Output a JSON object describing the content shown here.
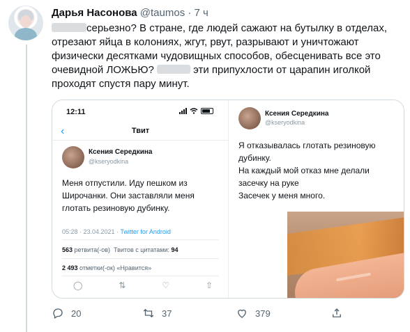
{
  "author": {
    "name": "Дарья Насонова",
    "handle": "@taumos",
    "time": "7 ч"
  },
  "tweet": {
    "line1": "серьезно? В стране, где людей сажают на бутылку в отделах,",
    "line2": "отрезают яйца в колониях, жгут, рвут, разрывают и уничтожают",
    "line3": "физически десятками чудовищных способов, обесценивать все это",
    "line4a": "очевидной ЛОЖЬЮ?",
    "line4b": "эти припухлости от царапин иголкой",
    "line5": "проходят спустя пару минут."
  },
  "screenshot_left": {
    "time": "12:11",
    "nav_back": "‹",
    "nav_title": "Твит",
    "name": "Ксения Середкина",
    "handle": "@kseryodkina",
    "text_l1": "Меня отпустили. Иду пешком из",
    "text_l2": "Широчанки. Они заставляли меня",
    "text_l3": "глотать резиновую дубинку.",
    "meta_time": "05:28 · 23.04.2021 · ",
    "meta_source": "Twitter for Android",
    "retweets_count": "563",
    "retweets_label": "ретвита(-ов)",
    "quotes_label": "Твитов с цитатами:",
    "quotes_count": "94",
    "likes_count": "2 493",
    "likes_label": "отметки(-ок) «Нравится»"
  },
  "screenshot_right": {
    "name": "Ксения Середкина",
    "handle": "@kseryodkina",
    "l1": "Я отказывалась глотать резиновую",
    "l2": "дубинку.",
    "l3": "На каждый мой отказ мне делали",
    "l4": "засечку на руке",
    "l5": "Засечек у меня много."
  },
  "actions": {
    "replies": "20",
    "retweets": "37",
    "likes": "379"
  },
  "colors": {
    "accent": "#1d9bf0",
    "text": "#0f1419",
    "secondary": "#536471"
  }
}
